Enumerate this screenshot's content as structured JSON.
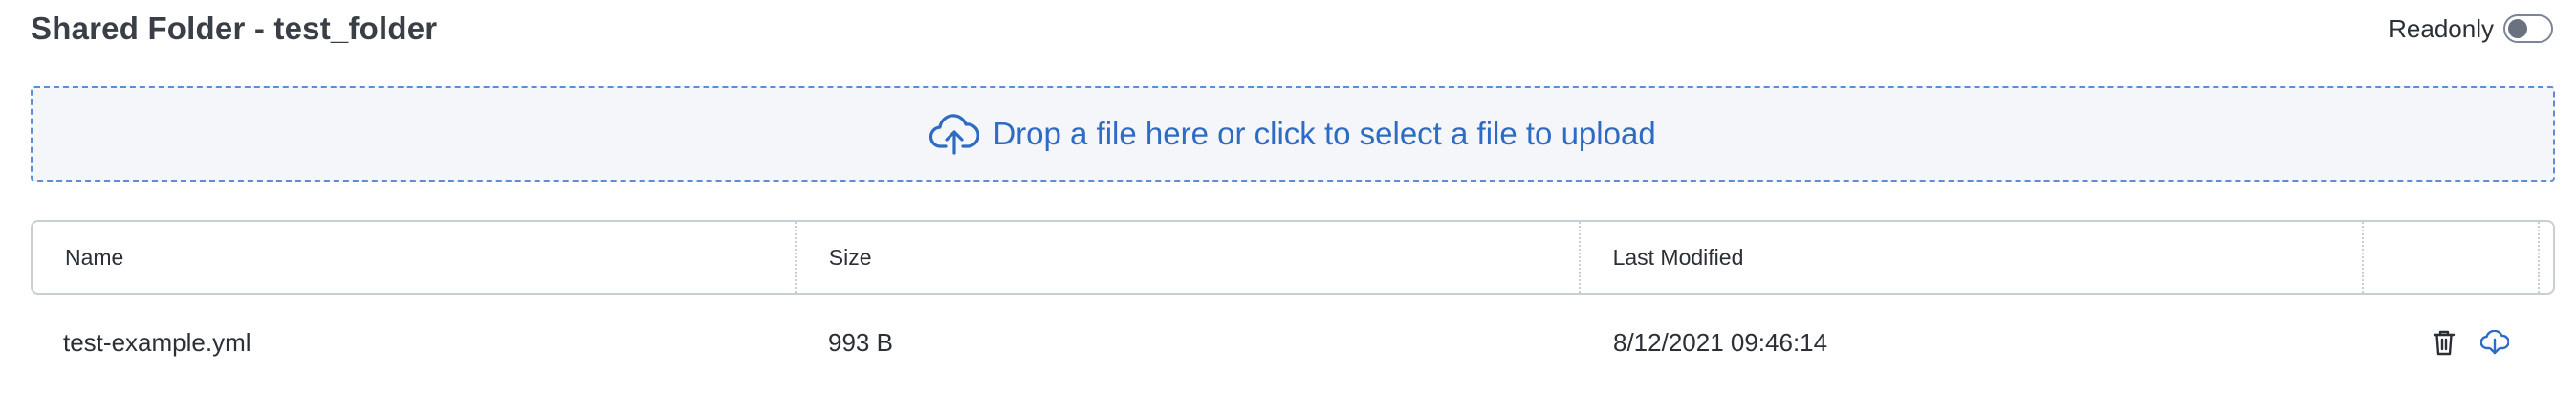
{
  "header": {
    "title": "Shared Folder - test_folder",
    "readonly_label": "Readonly",
    "readonly_on": false
  },
  "dropzone": {
    "text": "Drop a file here or click to select a file to upload",
    "icon": "cloud-upload-icon",
    "accent_color": "#2d6bc4"
  },
  "table": {
    "columns": [
      "Name",
      "Size",
      "Last Modified",
      ""
    ],
    "rows": [
      {
        "name": "test-example.yml",
        "size": "993 B",
        "last_modified": "8/12/2021 09:46:14",
        "actions": [
          "trash-icon",
          "cloud-download-icon"
        ]
      }
    ]
  }
}
